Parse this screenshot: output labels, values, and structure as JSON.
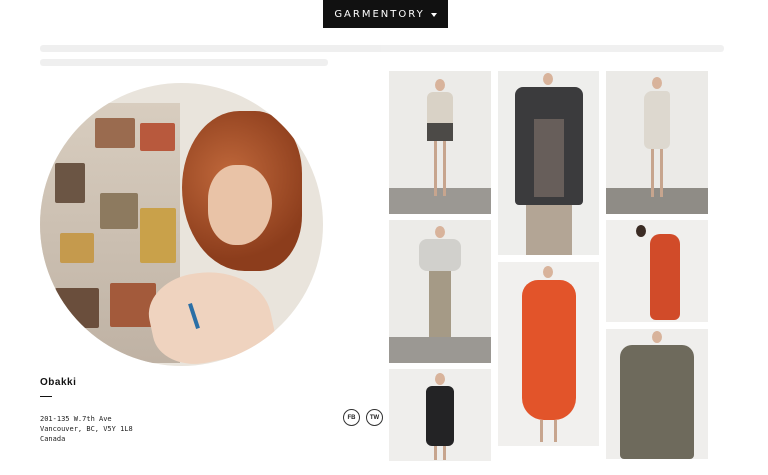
{
  "header": {
    "brand_label": "GARMENTORY"
  },
  "designer": {
    "name": "Obakki",
    "address": [
      "201-135 W.7th Ave",
      "Vancouver, BC, V5Y 1L8",
      "Canada"
    ]
  },
  "social": {
    "facebook_label": "FB",
    "twitter_label": "TW"
  },
  "colors": {
    "header_bg": "#111111",
    "accent_orange": "#e2542a"
  }
}
